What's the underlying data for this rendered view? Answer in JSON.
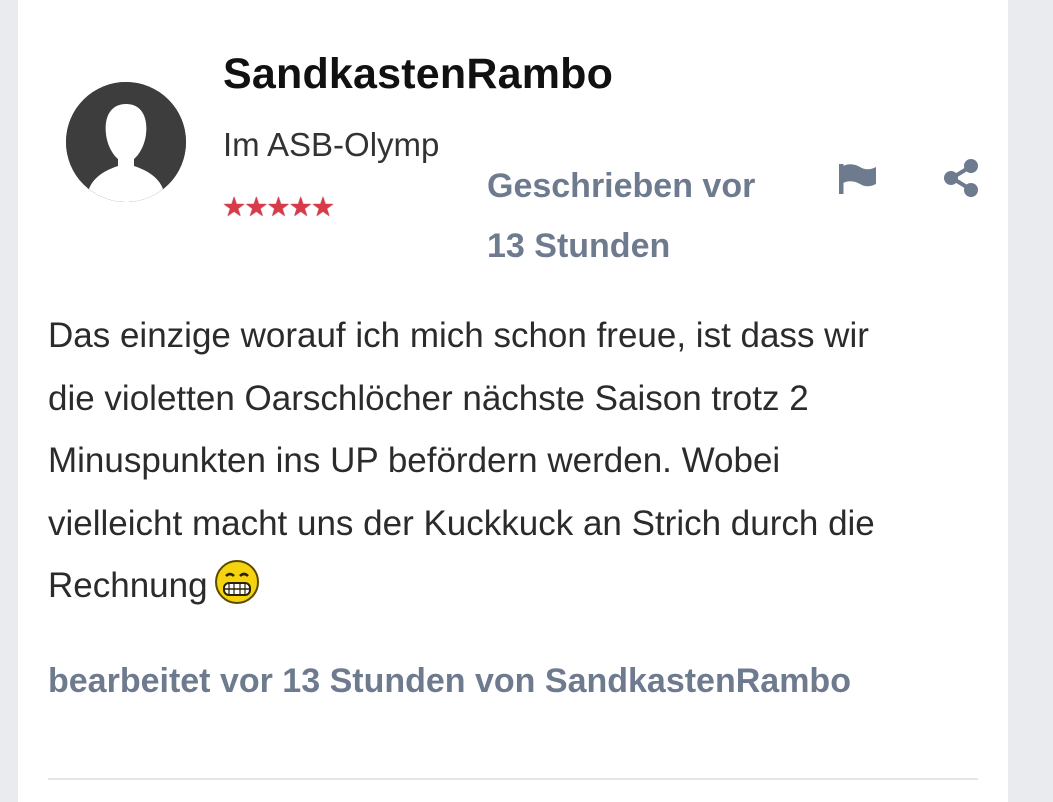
{
  "post": {
    "author": {
      "name": "SandkastenRambo",
      "rank": "Im ASB-Olymp",
      "stars": "★★★★★",
      "star_count": 5,
      "avatar_icon": "default-avatar-silhouette-icon"
    },
    "date_line1": "Geschrieben vor",
    "date_line2": "13 Stunden",
    "actions": {
      "report_icon": "flag-icon",
      "share_icon": "share-icon"
    },
    "body": {
      "lines": [
        "Das einzige worauf ich mich schon freue, ist dass wir",
        "die violetten Oarschlöcher nächste Saison trotz 2",
        "Minuspunkten ins UP befördern werden. Wobei",
        "vielleicht macht uns der Kuckkuck an Strich durch die",
        "Rechnung"
      ],
      "emoji_icon": "grinning-teeth-emoji-icon"
    },
    "edit_note": "bearbeitet vor 13 Stunden von SandkastenRambo"
  },
  "colors": {
    "meta_text": "#6e7b8f",
    "stars": "#d83a4a",
    "avatar_bg": "#3d3d3d",
    "card_bg": "#ffffff",
    "page_bg": "#eaebee"
  }
}
